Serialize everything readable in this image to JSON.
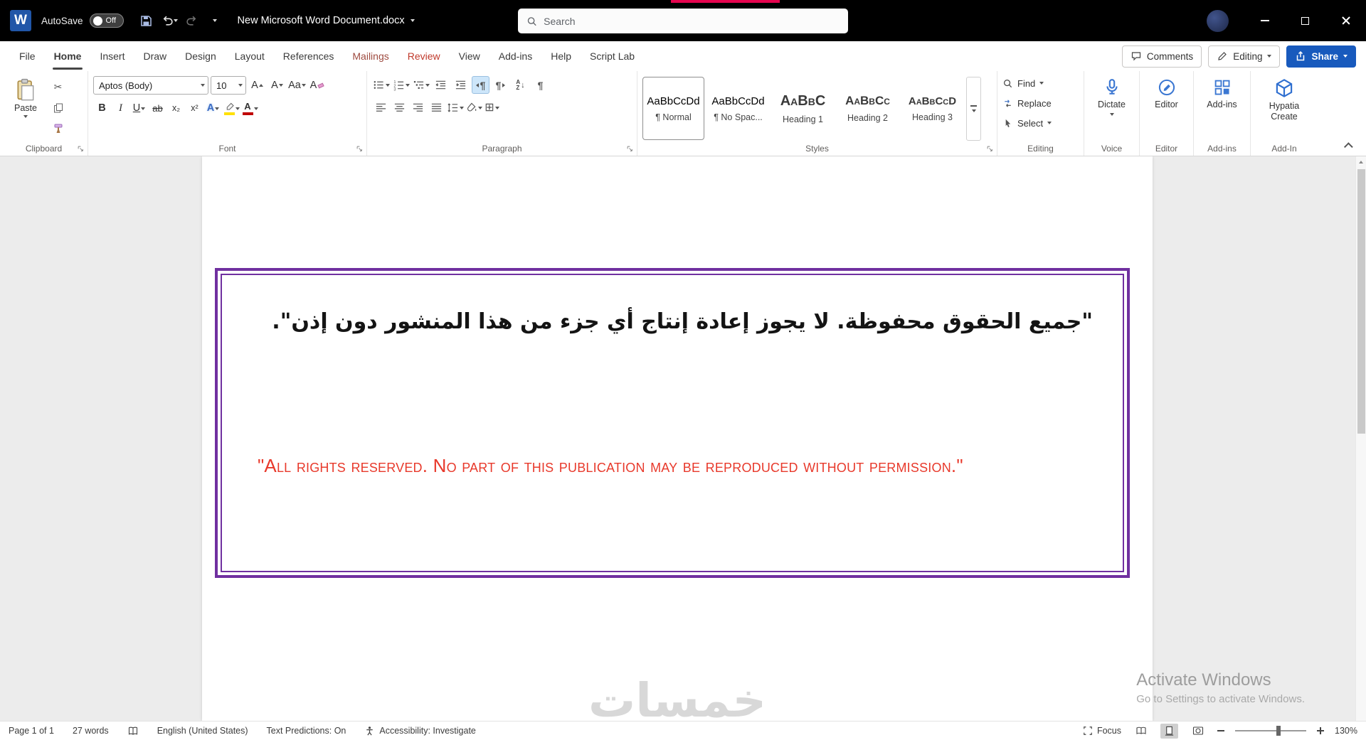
{
  "colors": {
    "accent_blue": "#185abd",
    "titlebar_bg": "#000000",
    "tab_mailings": "#9e4a3f",
    "tab_review": "#c0392b",
    "document_red": "#e8392b",
    "border_purple": "#7030a0"
  },
  "icons": {
    "word_logo_letter": "W",
    "scissors": "✂",
    "pilcrow": "¶",
    "borders_grid": "⊞",
    "letter_a": "A",
    "letter_z": "Z",
    "arrow_down": "↓"
  },
  "titlebar": {
    "autosave_label": "AutoSave",
    "autosave_state": "Off",
    "doc_title": "New Microsoft Word Document.docx",
    "search_placeholder": "Search"
  },
  "tabs": [
    {
      "label": "File"
    },
    {
      "label": "Home"
    },
    {
      "label": "Insert"
    },
    {
      "label": "Draw"
    },
    {
      "label": "Design"
    },
    {
      "label": "Layout"
    },
    {
      "label": "References"
    },
    {
      "label": "Mailings"
    },
    {
      "label": "Review"
    },
    {
      "label": "View"
    },
    {
      "label": "Add-ins"
    },
    {
      "label": "Help"
    },
    {
      "label": "Script Lab"
    }
  ],
  "top_right": {
    "comments": "Comments",
    "editing": "Editing",
    "share": "Share"
  },
  "ribbon": {
    "clipboard": {
      "paste": "Paste",
      "label": "Clipboard"
    },
    "font": {
      "name": "Aptos (Body)",
      "size": "10",
      "grow": "A",
      "shrink": "A",
      "change_case": "Aa",
      "clear": "A",
      "bold": "B",
      "italic": "I",
      "underline": "U",
      "strikethrough": "ab",
      "subscript": "x₂",
      "superscript": "x²",
      "effects": "A",
      "color": "A",
      "label": "Font"
    },
    "paragraph": {
      "label": "Paragraph"
    },
    "styles": {
      "items": [
        {
          "preview": "AaBbCcDd",
          "name": "¶ Normal"
        },
        {
          "preview": "AaBbCcDd",
          "name": "¶ No Spac..."
        },
        {
          "preview": "AaBbC",
          "name": "Heading 1"
        },
        {
          "preview": "AaBbCc",
          "name": "Heading 2"
        },
        {
          "preview": "AaBbCcD",
          "name": "Heading 3"
        }
      ],
      "label": "Styles"
    },
    "editing": {
      "find": "Find",
      "replace": "Replace",
      "select": "Select",
      "label": "Editing"
    },
    "voice": {
      "dictate": "Dictate",
      "label": "Voice"
    },
    "editor": {
      "button": "Editor",
      "label": "Editor"
    },
    "addins": {
      "button": "Add-ins",
      "label": "Add-ins"
    },
    "hypatia": {
      "button": "Hypatia Create",
      "label": "Add-In"
    }
  },
  "document": {
    "arabic_text": "\"جميع الحقوق محفوظة. لا يجوز إعادة إنتاج أي جزء من هذا المنشور دون إذن\".",
    "english_text": "\"All rights reserved. No part of this publication may be reproduced without permission.\"",
    "watermark": "خمسات",
    "activate_title": "Activate Windows",
    "activate_sub": "Go to Settings to activate Windows."
  },
  "statusbar": {
    "page_info": "Page 1 of 1",
    "word_count": "27 words",
    "language": "English (United States)",
    "predictions": "Text Predictions: On",
    "accessibility": "Accessibility: Investigate",
    "focus": "Focus",
    "zoom": "130%"
  }
}
